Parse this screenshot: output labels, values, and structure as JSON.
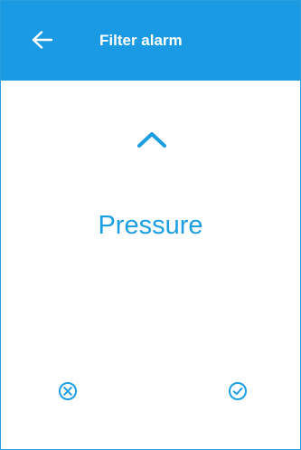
{
  "header": {
    "title": "Filter alarm",
    "back_icon": "arrow-left-icon"
  },
  "selector": {
    "up_icon": "chevron-up-icon",
    "value": "Pressure"
  },
  "actions": {
    "cancel_icon": "circle-x-icon",
    "confirm_icon": "circle-check-icon"
  },
  "colors": {
    "header_bg": "#1a9ae3",
    "accent": "#1c9ee3",
    "header_text": "#ffffff"
  }
}
